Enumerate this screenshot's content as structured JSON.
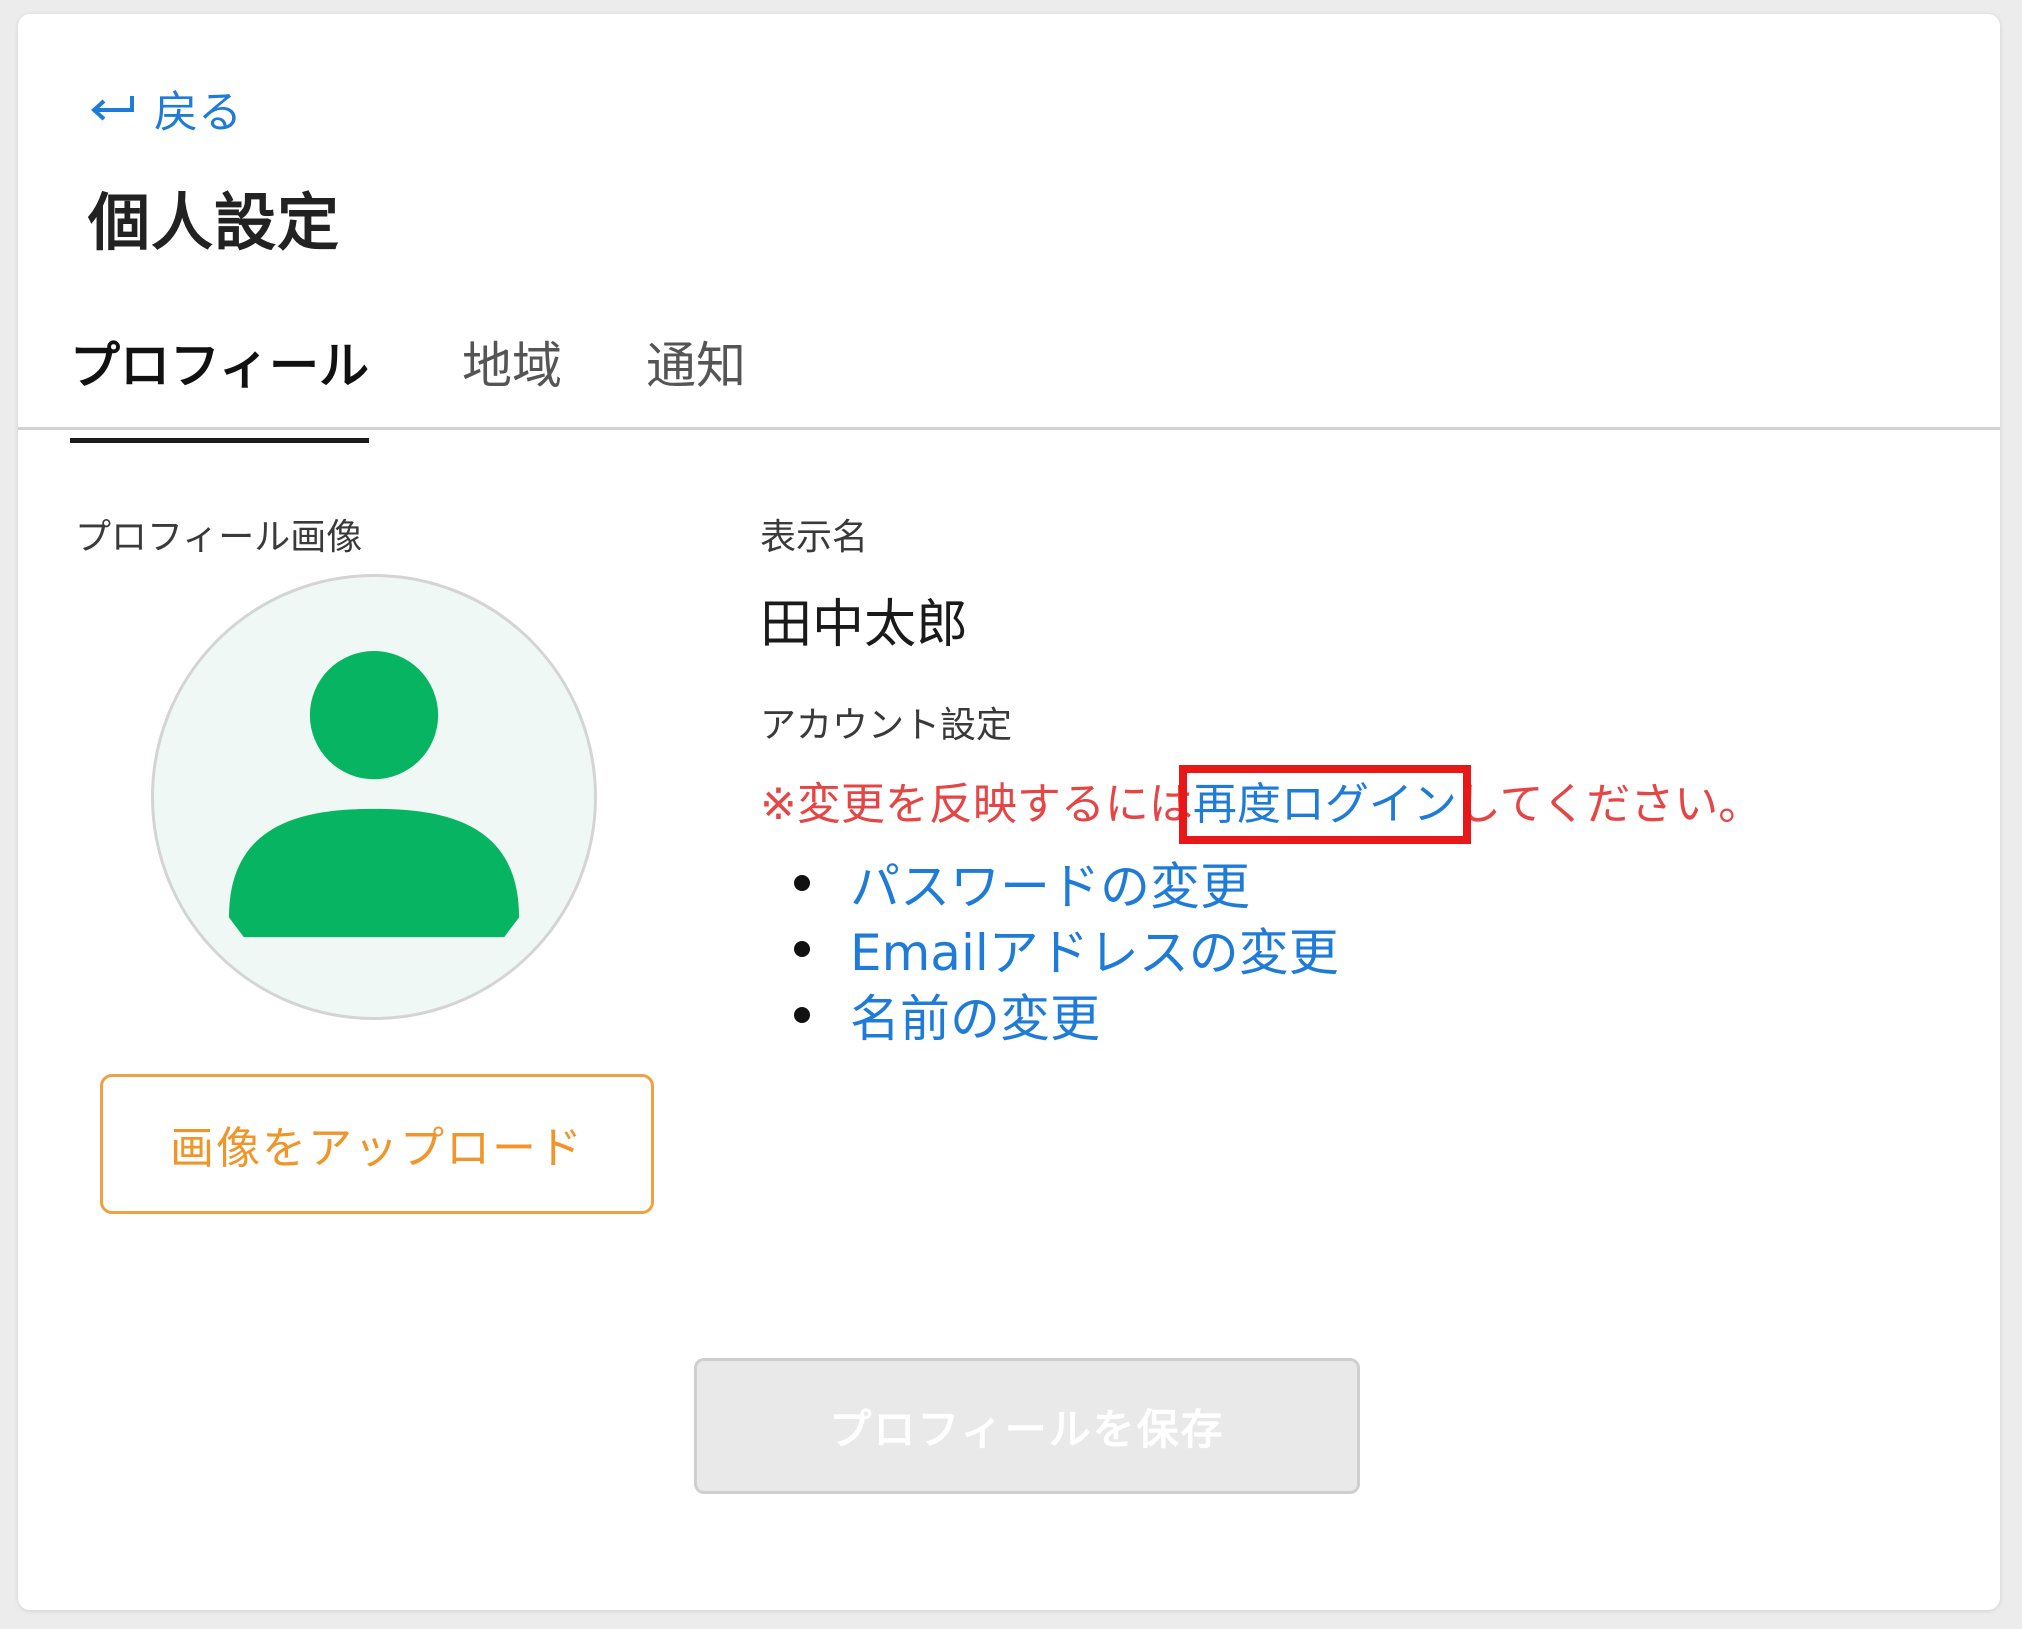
{
  "header": {
    "back_label": "戻る",
    "title": "個人設定"
  },
  "tabs": [
    {
      "label": "プロフィール",
      "active": true
    },
    {
      "label": "地域",
      "active": false
    },
    {
      "label": "通知",
      "active": false
    }
  ],
  "profile_image": {
    "label": "プロフィール画像",
    "upload_button": "画像をアップロード"
  },
  "display_name": {
    "label": "表示名",
    "value": "田中太郎"
  },
  "account_settings": {
    "label": "アカウント設定",
    "note_prefix": "※変更を反映するには",
    "relogin_link": "再度ログイン",
    "note_suffix": "してください。",
    "links": [
      "パスワードの変更",
      "Emailアドレスの変更",
      "名前の変更"
    ]
  },
  "save_button": "プロフィールを保存",
  "colors": {
    "link": "#1f7bd8",
    "warning": "#e64545",
    "avatar_green": "#07b462",
    "upload_orange": "#f0952a",
    "highlight_red": "#e81818"
  }
}
